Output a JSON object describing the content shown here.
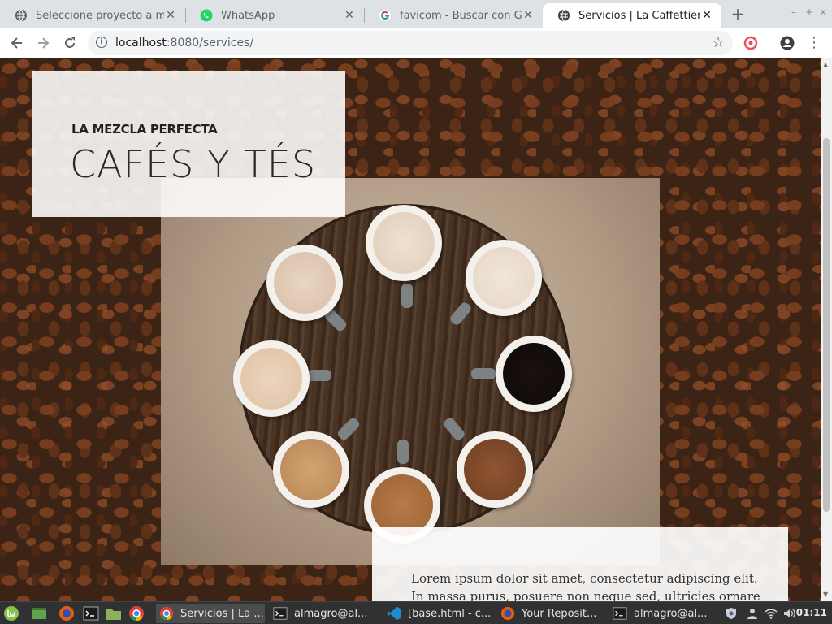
{
  "browser": {
    "tabs": [
      {
        "title": "Seleccione proyecto a mod",
        "active": false,
        "icon": "globe-icon"
      },
      {
        "title": "WhatsApp",
        "active": false,
        "icon": "whatsapp-icon"
      },
      {
        "title": "favicom - Buscar con Goog",
        "active": false,
        "icon": "google-icon"
      },
      {
        "title": "Servicios | La Caffettiera",
        "active": true,
        "icon": "globe-icon"
      }
    ],
    "url_host": "localhost",
    "url_rest": ":8080/services/"
  },
  "page": {
    "subheading": "LA MEZCLA PERFECTA",
    "heading": "CAFÉS Y TÉS",
    "lorem_1": "Lorem ipsum dolor sit amet, consectetur adipiscing elit.",
    "lorem_2": "In massa purus, posuere non neque sed, ultricies ornare"
  },
  "taskbar": {
    "items": [
      {
        "label": "Servicios | La ...",
        "icon": "chrome-icon",
        "active": true
      },
      {
        "label": "almagro@al...",
        "icon": "terminal-icon",
        "active": false
      },
      {
        "label": "[base.html - c...",
        "icon": "vscode-icon",
        "active": false
      },
      {
        "label": "Your Reposit...",
        "icon": "firefox-icon",
        "active": false
      },
      {
        "label": "almagro@al...",
        "icon": "terminal-icon",
        "active": false
      }
    ],
    "clock": "01:11"
  },
  "colors": {
    "accent_chrome": "#dee1e6",
    "text_dark": "#2a2a2a",
    "taskbar": "#2f3133"
  }
}
